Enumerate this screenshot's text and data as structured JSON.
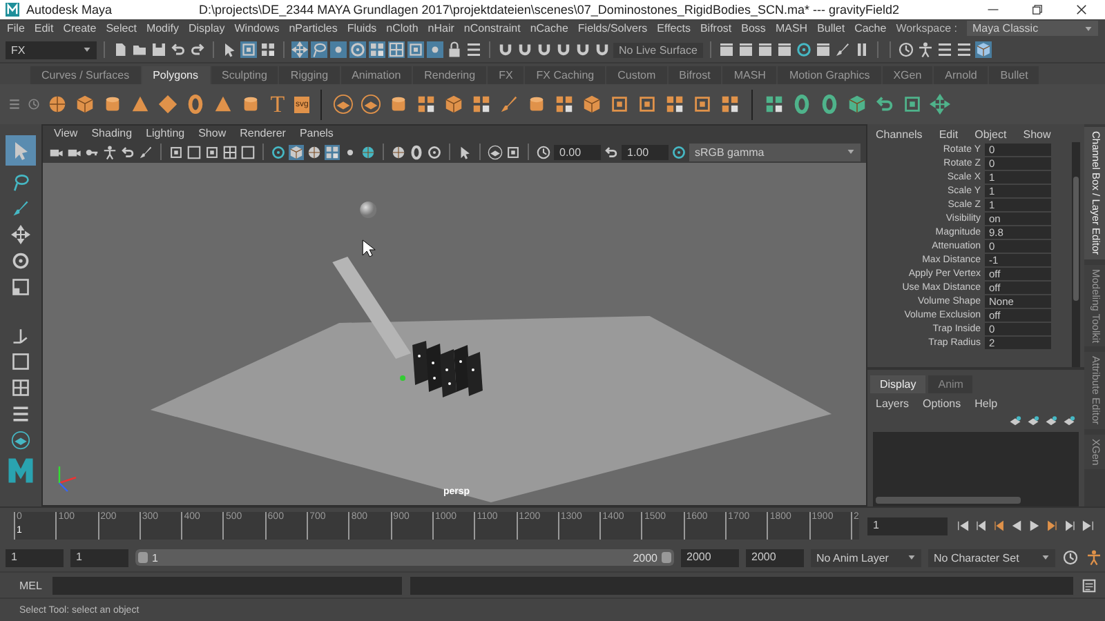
{
  "window": {
    "app_title": "Autodesk Maya",
    "title": "D:\\projects\\DE_2344 MAYA Grundlagen 2017\\projektdateien\\scenes\\07_Dominostones_RigidBodies_SCN.ma*  ---  gravityField2"
  },
  "menu_bar": {
    "items": [
      "File",
      "Edit",
      "Create",
      "Select",
      "Modify",
      "Display",
      "Windows",
      "nParticles",
      "Fluids",
      "nCloth",
      "nHair",
      "nConstraint",
      "nCache",
      "Fields/Solvers",
      "Effects",
      "Bifrost",
      "Boss",
      "MASH",
      "Bullet",
      "Cache"
    ],
    "workspace_label": "Workspace :",
    "workspace": "Maya Classic"
  },
  "status_line": {
    "menu_set": "FX",
    "live_surface": "No Live Surface"
  },
  "shelf": {
    "tabs": [
      {
        "label": "Curves / Surfaces",
        "selected": false
      },
      {
        "label": "Polygons",
        "selected": true
      },
      {
        "label": "Sculpting",
        "selected": false
      },
      {
        "label": "Rigging",
        "selected": false
      },
      {
        "label": "Animation",
        "selected": false
      },
      {
        "label": "Rendering",
        "selected": false
      },
      {
        "label": "FX",
        "selected": false
      },
      {
        "label": "FX Caching",
        "selected": false
      },
      {
        "label": "Custom",
        "selected": false
      },
      {
        "label": "Bifrost",
        "selected": false
      },
      {
        "label": "MASH",
        "selected": false
      },
      {
        "label": "Motion Graphics",
        "selected": false
      },
      {
        "label": "XGen",
        "selected": false
      },
      {
        "label": "Arnold",
        "selected": false
      },
      {
        "label": "Bullet",
        "selected": false
      }
    ],
    "text_tool_label": "T",
    "svg_tool_label": "svg"
  },
  "viewport": {
    "menus": [
      "View",
      "Shading",
      "Lighting",
      "Show",
      "Renderer",
      "Panels"
    ],
    "exposure": "0.00",
    "gamma": "1.00",
    "color_space": "sRGB gamma",
    "camera": "persp"
  },
  "channel_box": {
    "menus": [
      "Channels",
      "Edit",
      "Object",
      "Show"
    ],
    "channels": [
      {
        "name": "Rotate Y",
        "value": "0"
      },
      {
        "name": "Rotate Z",
        "value": "0"
      },
      {
        "name": "Scale X",
        "value": "1"
      },
      {
        "name": "Scale Y",
        "value": "1"
      },
      {
        "name": "Scale Z",
        "value": "1"
      },
      {
        "name": "Visibility",
        "value": "on"
      },
      {
        "name": "Magnitude",
        "value": "9.8"
      },
      {
        "name": "Attenuation",
        "value": "0"
      },
      {
        "name": "Max Distance",
        "value": "-1"
      },
      {
        "name": "Apply Per Vertex",
        "value": "off"
      },
      {
        "name": "Use Max Distance",
        "value": "off"
      },
      {
        "name": "Volume Shape",
        "value": "None"
      },
      {
        "name": "Volume Exclusion",
        "value": "off"
      },
      {
        "name": "Trap Inside",
        "value": "0"
      },
      {
        "name": "Trap Radius",
        "value": "2"
      }
    ]
  },
  "layer_editor": {
    "tabs": [
      {
        "label": "Display",
        "selected": true
      },
      {
        "label": "Anim",
        "selected": false
      }
    ],
    "menus": [
      "Layers",
      "Options",
      "Help"
    ]
  },
  "side_tabs": [
    {
      "label": "Channel Box / Layer Editor",
      "selected": true
    },
    {
      "label": "Modeling Toolkit",
      "selected": false
    },
    {
      "label": "Attribute Editor",
      "selected": false
    },
    {
      "label": "XGen",
      "selected": false
    }
  ],
  "time_slider": {
    "ticks": [
      "0",
      "100",
      "200",
      "300",
      "400",
      "500",
      "600",
      "700",
      "800",
      "900",
      "1000",
      "1100",
      "1200",
      "1300",
      "1400",
      "1500",
      "1600",
      "1700",
      "1800",
      "1900",
      "2"
    ],
    "current_frame_marker": "1",
    "current_frame": "1"
  },
  "range_slider": {
    "start": "1",
    "playback_start": "1",
    "range_start": "1",
    "range_end": "2000",
    "level": 1,
    "playback_end": "2000",
    "end": "2000",
    "anim_layer": "No Anim Layer",
    "character_set": "No Character Set"
  },
  "command_line": {
    "language": "MEL"
  },
  "help_line": "Select Tool: select an object"
}
